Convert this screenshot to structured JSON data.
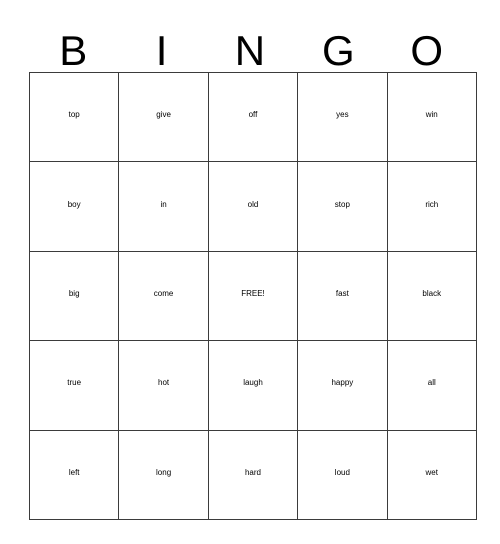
{
  "card": {
    "title": "BINGO",
    "header_letters": [
      "B",
      "I",
      "N",
      "G",
      "O"
    ],
    "columns": 5,
    "rows": 5,
    "free_space": {
      "row": 2,
      "col": 2,
      "label": "FREE!"
    },
    "colors": {
      "background": "#ffffff",
      "text": "#000000",
      "grid_line": "#3b3b3b"
    },
    "grid": [
      [
        "top",
        "give",
        "off",
        "yes",
        "win"
      ],
      [
        "boy",
        "in",
        "old",
        "stop",
        "rich"
      ],
      [
        "big",
        "come",
        "FREE!",
        "fast",
        "black"
      ],
      [
        "true",
        "hot",
        "laugh",
        "happy",
        "all"
      ],
      [
        "left",
        "long",
        "hard",
        "loud",
        "wet"
      ]
    ]
  }
}
